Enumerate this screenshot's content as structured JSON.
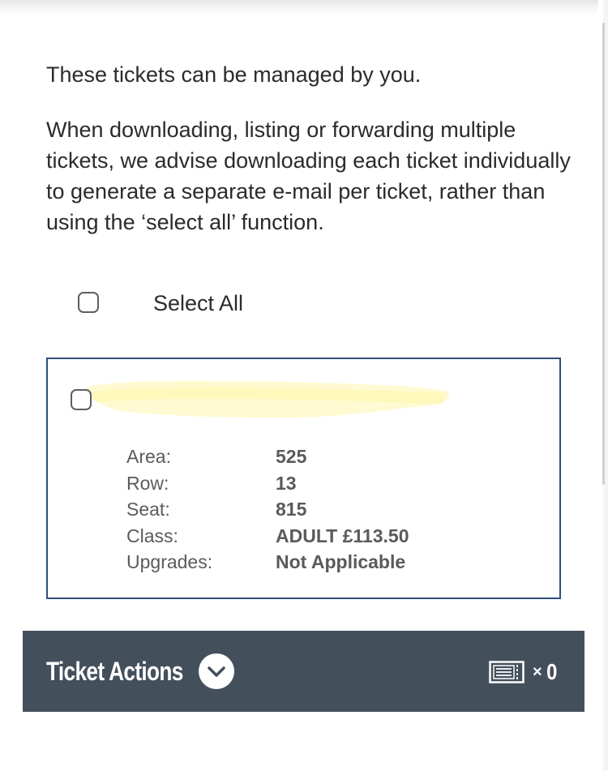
{
  "intro": {
    "line1": "These tickets can be managed by you.",
    "line2": "When downloading, listing or forwarding multiple tickets, we advise downloading each ticket individually to generate a separate e-mail per ticket, rather than using the ‘select all’ function."
  },
  "select_all": {
    "label": "Select All",
    "checked": false
  },
  "ticket": {
    "checked": false,
    "details": [
      {
        "label": "Area:",
        "value": "525"
      },
      {
        "label": "Row:",
        "value": "13"
      },
      {
        "label": "Seat:",
        "value": "815"
      },
      {
        "label": "Class:",
        "value": "ADULT £113.50"
      },
      {
        "label": "Upgrades:",
        "value": "Not Applicable"
      }
    ]
  },
  "actions_bar": {
    "title": "Ticket Actions",
    "count_prefix": "×",
    "count": "0",
    "chevron_icon": "chevron-down-icon",
    "ticket_icon": "ticket-icon"
  },
  "colors": {
    "bar_background": "#444f5c",
    "card_border": "#2c4f7c",
    "redaction_highlight": "#fffad0"
  }
}
